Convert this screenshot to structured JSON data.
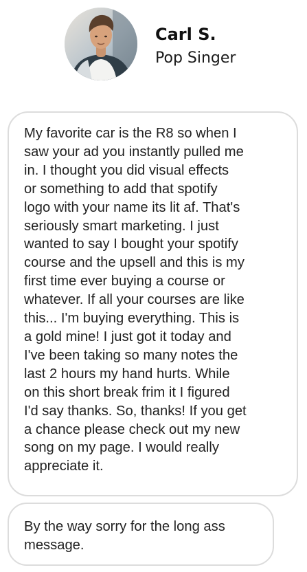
{
  "profile": {
    "name": "Carl S.",
    "role": "Pop Singer",
    "avatar_icon": "person-avatar"
  },
  "messages": [
    {
      "lines": [
        "My favorite car is the R8 so when I",
        "saw your ad you instantly pulled me",
        "in. I thought you did visual effects",
        "or something to add that spotify",
        "logo with your name its lit af. That's",
        "seriously smart marketing. I just",
        "wanted to say I bought your spotify",
        "course and the upsell and this is my",
        "first time ever buying a course or",
        "whatever. If all your courses are like",
        "this... I'm buying everything. This is",
        "a  gold mine! I just got it today and",
        "I've been taking so many notes the",
        "last 2 hours my hand hurts. While",
        "on this short break frim it I figured",
        "I'd say thanks. So, thanks! If you get",
        "a chance please check out my new",
        "song on my page. I would really",
        "appreciate it."
      ]
    },
    {
      "lines": [
        "By the way sorry for the long ass",
        "message."
      ]
    }
  ],
  "colors": {
    "bubble_border": "#dcdcdc",
    "text": "#222222",
    "background": "#ffffff"
  }
}
